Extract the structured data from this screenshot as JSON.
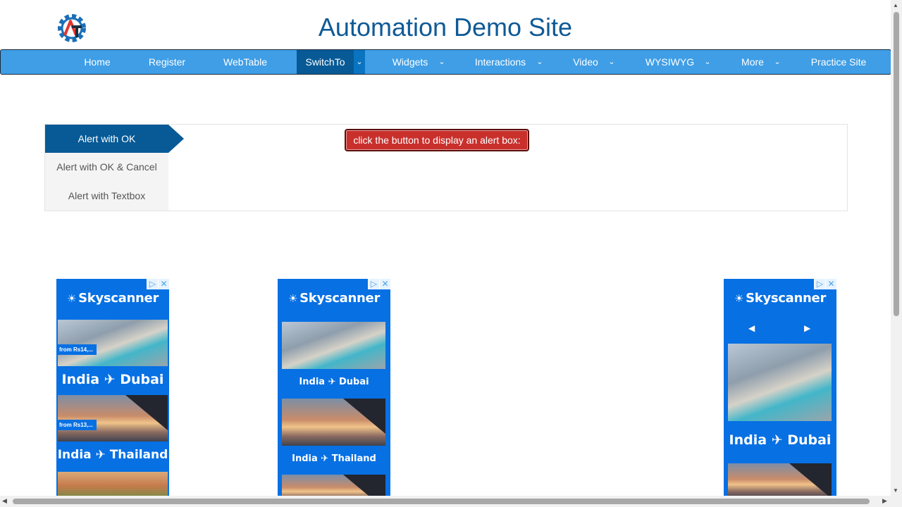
{
  "header": {
    "title": "Automation Demo Site",
    "logo_icon": "gear-at-logo",
    "logo_colors": [
      "#1a6fb8",
      "#e0372f",
      "#1f2d3d"
    ]
  },
  "nav": {
    "items": [
      {
        "label": "Home",
        "has_dropdown": false
      },
      {
        "label": "Register",
        "has_dropdown": false
      },
      {
        "label": "WebTable",
        "has_dropdown": false
      },
      {
        "label": "SwitchTo",
        "has_dropdown": true,
        "active": true
      },
      {
        "label": "Widgets",
        "has_dropdown": true
      },
      {
        "label": "Interactions",
        "has_dropdown": true
      },
      {
        "label": "Video",
        "has_dropdown": true
      },
      {
        "label": "WYSIWYG",
        "has_dropdown": true
      },
      {
        "label": "More",
        "has_dropdown": true
      },
      {
        "label": "Practice Site",
        "has_dropdown": false
      }
    ],
    "caret_icon": "chevron-down-icon",
    "colors": {
      "bar": "#3f9ee6",
      "active": "#075a96"
    }
  },
  "alerts": {
    "tabs": [
      {
        "label": "Alert with OK",
        "active": true
      },
      {
        "label": "Alert with OK & Cancel"
      },
      {
        "label": "Alert with Textbox"
      }
    ],
    "button_label": "click the button to display an alert box:",
    "button_color": "#c9302c"
  },
  "ads": {
    "brand": "Skyscanner",
    "ad_choices_icon": "ad-choices-icon",
    "close_icon": "close-icon",
    "left": {
      "routes": [
        {
          "label": "India ✈ Dubai",
          "price": "from Rs14,..."
        },
        {
          "label": "India ✈ Thailand",
          "price": "from Rs13,..."
        }
      ]
    },
    "middle": {
      "routes": [
        {
          "label": "India ✈ Dubai"
        },
        {
          "label": "India ✈ Thailand"
        }
      ]
    },
    "right": {
      "routes": [
        {
          "label": "India ✈ Dubai"
        }
      ],
      "prev": "◀",
      "next": "▶"
    },
    "background": "#0770e3"
  }
}
